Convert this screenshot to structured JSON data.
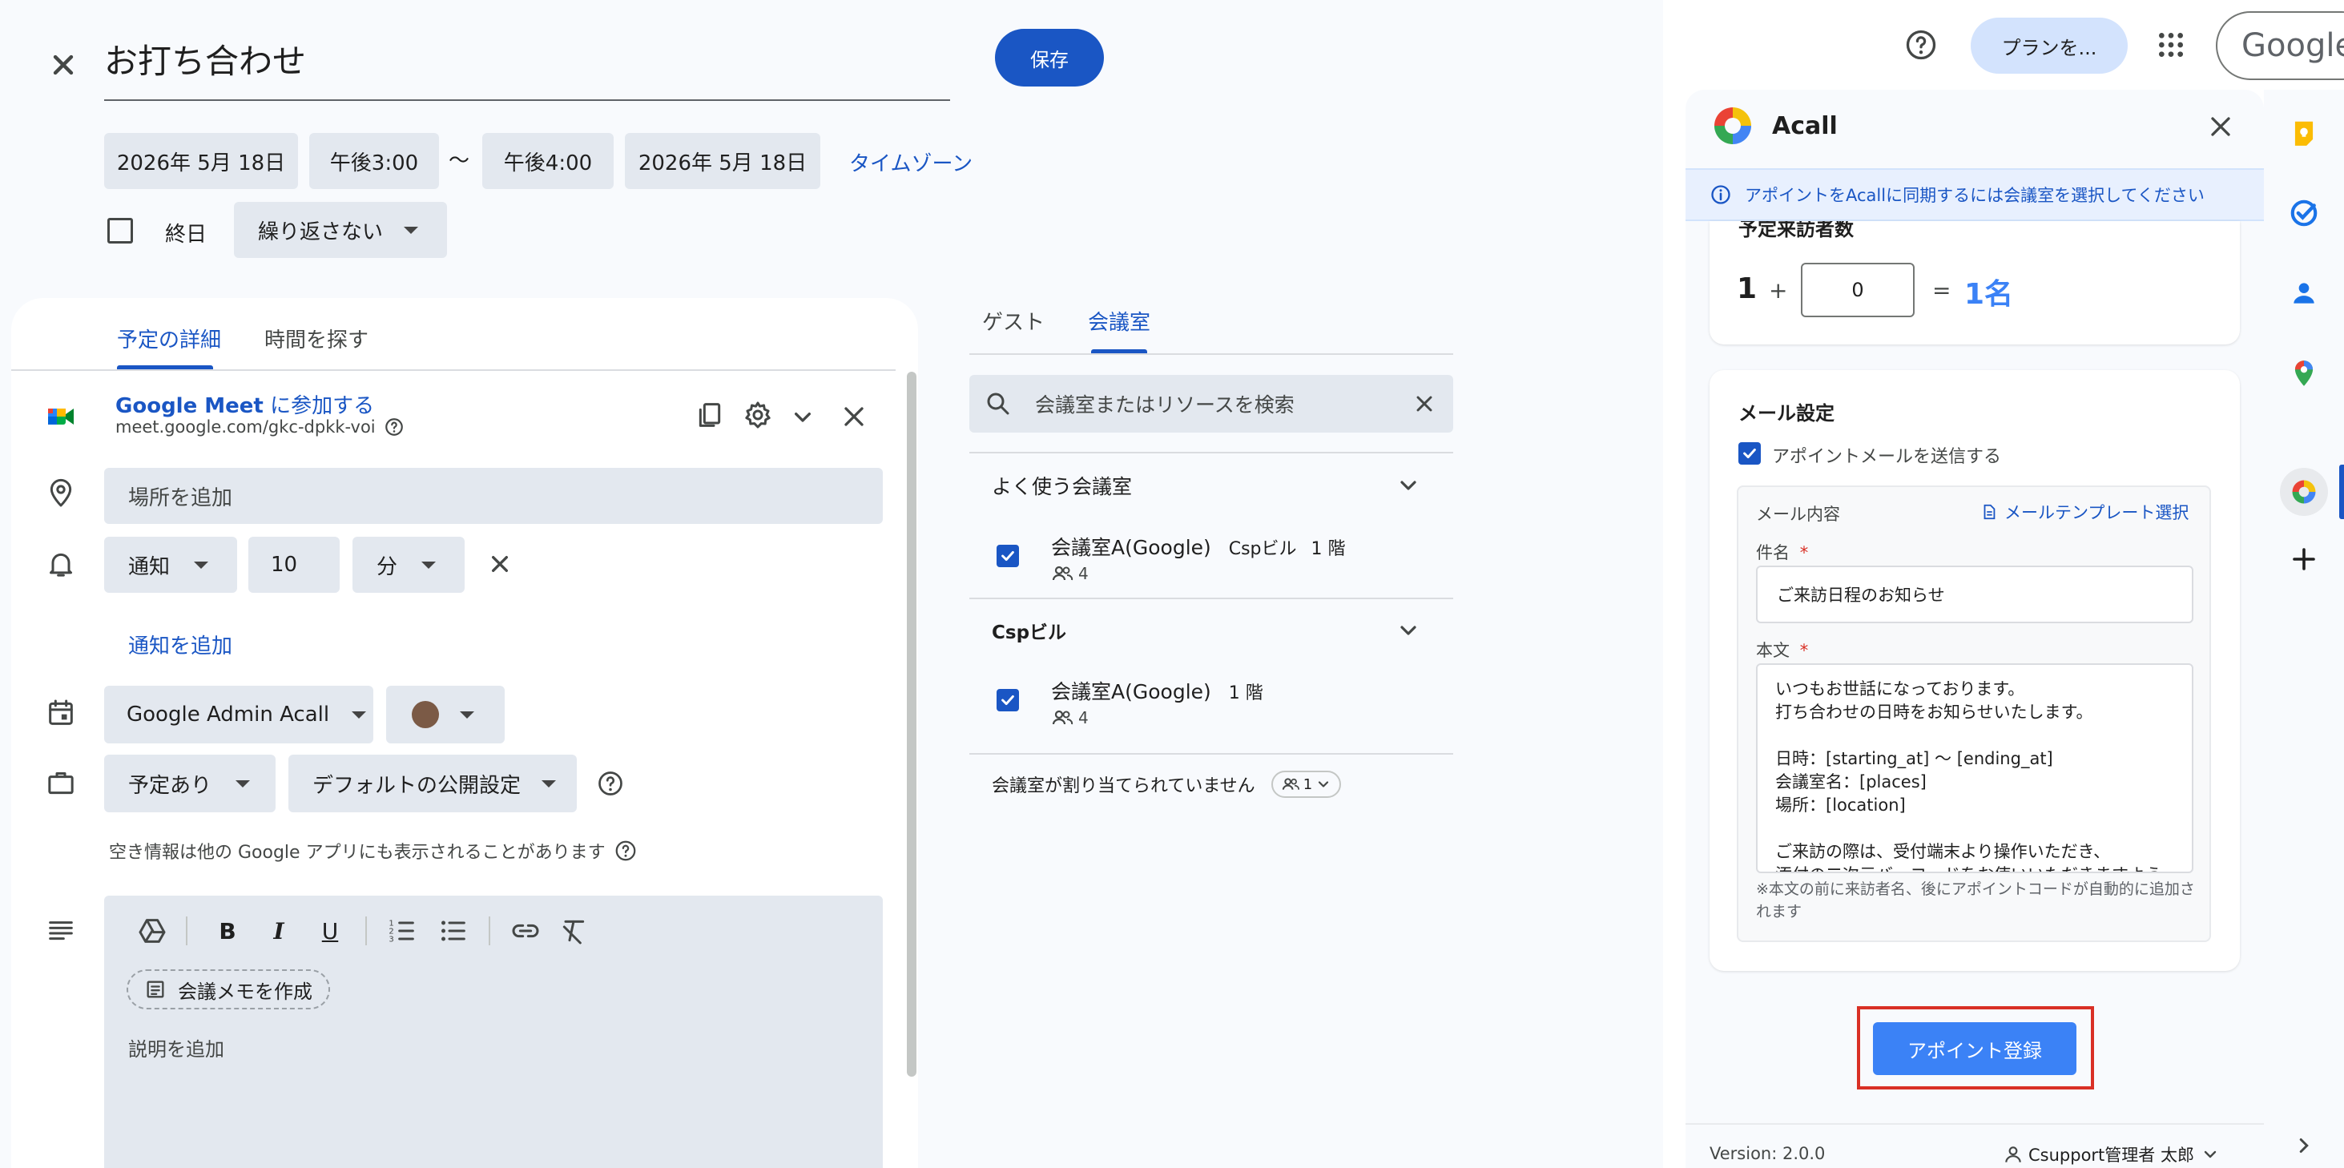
{
  "header": {
    "title": "お打ち合わせ",
    "save_label": "保存",
    "start_date": "2026年 5月 18日",
    "start_time": "午後3:00",
    "separator": "〜",
    "end_time": "午後4:00",
    "end_date": "2026年 5月 18日",
    "timezone_label": "タイムゾーン",
    "all_day_label": "終日",
    "repeat_label": "繰り返さない"
  },
  "topbar": {
    "plan_button": "プランを...",
    "google_logo": "Google"
  },
  "details": {
    "tabs": [
      "予定の詳細",
      "時間を探す"
    ],
    "meet_title_main": "Google Meet",
    "meet_title_suffix": " に参加する",
    "meet_link": "meet.google.com/gkc-dpkk-voi",
    "location_placeholder": "場所を追加",
    "notify_type": "通知",
    "notify_value": "10",
    "notify_unit": "分",
    "add_notification": "通知を追加",
    "calendar_name": "Google Admin Acall",
    "event_color": "#7b5a46",
    "availability": "予定あり",
    "visibility": "デフォルトの公開設定",
    "availability_note": "空き情報は他の Google アプリにも表示されることがあります",
    "meeting_notes_label": "会議メモを作成",
    "description_placeholder": "説明を追加"
  },
  "rooms": {
    "tabs": [
      "ゲスト",
      "会議室"
    ],
    "search_placeholder": "会議室またはリソースを検索",
    "section1_title": "よく使う会議室",
    "room1_name": "会議室A(Google)",
    "room1_building": "Cspビル",
    "room1_floor": "1 階",
    "room1_capacity": "4",
    "section2_title": "Cspビル",
    "room2_name": "会議室A(Google)",
    "room2_floor": "1 階",
    "room2_capacity": "4",
    "unassigned_text": "会議室が割り当てられていません",
    "unassigned_count": "1"
  },
  "acall": {
    "title": "Acall",
    "info_text": "アポイントをAcallに同期するには会議室を選択してください",
    "visitor_section_title": "予定来訪者数",
    "visitor_base": "1",
    "plus": "+",
    "visitor_input": "0",
    "equals": "=",
    "visitor_total": "1名",
    "mail_section_title": "メール設定",
    "send_mail_label": "アポイントメールを送信する",
    "mail_content_label": "メール内容",
    "template_link": "メールテンプレート選択",
    "subject_label": "件名",
    "required_mark": "*",
    "subject_value": "ご来訪日程のお知らせ",
    "body_label": "本文",
    "body_lines": [
      "いつもお世話になっております。",
      "打ち合わせの日時をお知らせいたします。",
      "",
      "日時：[starting_at] 〜 [ending_at]",
      "会議室名：[places]",
      "場所：[location]",
      "",
      "ご来訪の際は、受付端末より操作いただき、",
      "添付の二次元バーコードをお使いいただきますよう"
    ],
    "body_note": "※本文の前に来訪者名、後にアポイントコードが自動的に追加されます",
    "submit_label": "アポイント登録",
    "version": "Version: 2.0.0",
    "user": "Csupport管理者 太郎"
  },
  "colors": {
    "accent": "#1a56c4",
    "highlight_border": "#d93025"
  }
}
